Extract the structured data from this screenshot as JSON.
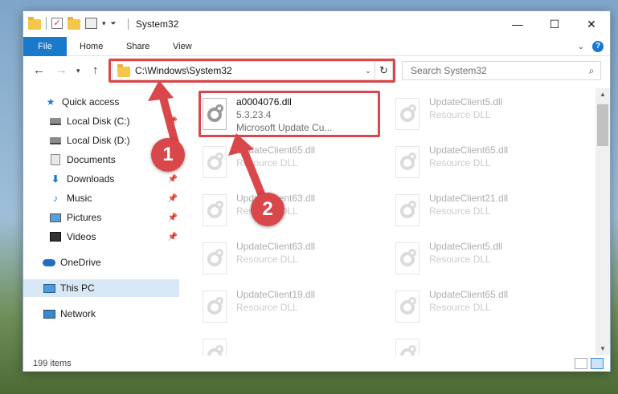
{
  "window": {
    "title": "System32"
  },
  "ribbon": {
    "tabs": [
      "File",
      "Home",
      "Share",
      "View"
    ]
  },
  "address": {
    "path": "C:\\Windows\\System32"
  },
  "search": {
    "placeholder": "Search System32"
  },
  "sidebar": {
    "items": [
      {
        "label": "Quick access",
        "icon": "star-icon"
      },
      {
        "label": "Local Disk (C:)",
        "icon": "drive-icon"
      },
      {
        "label": "Local Disk (D:)",
        "icon": "drive-icon"
      },
      {
        "label": "Documents",
        "icon": "documents-icon"
      },
      {
        "label": "Downloads",
        "icon": "download-icon"
      },
      {
        "label": "Music",
        "icon": "music-icon"
      },
      {
        "label": "Pictures",
        "icon": "pictures-icon"
      },
      {
        "label": "Videos",
        "icon": "videos-icon"
      },
      {
        "label": "OneDrive",
        "icon": "cloud-icon"
      },
      {
        "label": "This PC",
        "icon": "computer-icon"
      },
      {
        "label": "Network",
        "icon": "network-icon"
      }
    ]
  },
  "files": {
    "selected": {
      "name": "a0004076.dll",
      "version": "5.3.23.4",
      "description": "Microsoft Update Cu..."
    },
    "col1": [
      {
        "name": "UpdateClient65.dll",
        "sub": "Resource DLL"
      },
      {
        "name": "UpdateClient63.dll",
        "sub": "Resource DLL"
      },
      {
        "name": "UpdateClient63.dll",
        "sub": "Resource DLL"
      },
      {
        "name": "UpdateClient19.dll",
        "sub": "Resource DLL"
      }
    ],
    "col2": [
      {
        "name": "UpdateClient5.dll",
        "sub": "Resource DLL"
      },
      {
        "name": "UpdateClient65.dll",
        "sub": "Resource DLL"
      },
      {
        "name": "UpdateClient21.dll",
        "sub": "Resource DLL"
      },
      {
        "name": "UpdateClient5.dll",
        "sub": "Resource DLL"
      },
      {
        "name": "UpdateClient65.dll",
        "sub": "Resource DLL"
      }
    ]
  },
  "status": {
    "item_count": "199 items"
  },
  "annotations": {
    "callout1": "1",
    "callout2": "2"
  },
  "colors": {
    "accent": "#1979ca",
    "highlight": "#d9474a"
  }
}
